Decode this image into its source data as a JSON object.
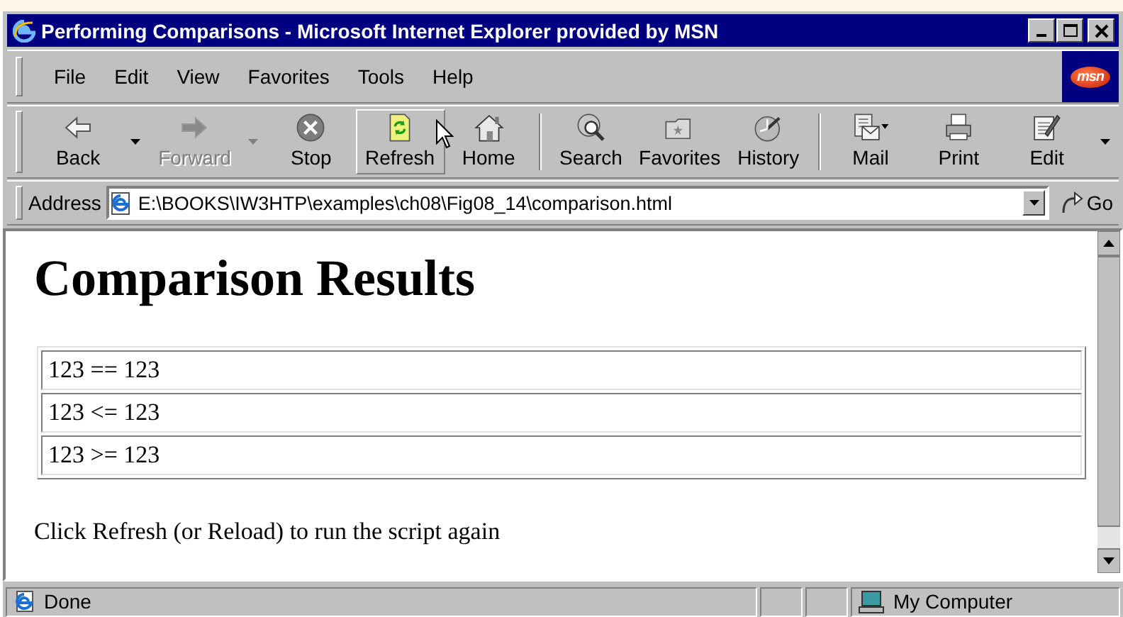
{
  "window": {
    "title": "Performing Comparisons - Microsoft Internet Explorer provided by MSN"
  },
  "menu": [
    {
      "label": "File"
    },
    {
      "label": "Edit"
    },
    {
      "label": "View"
    },
    {
      "label": "Favorites"
    },
    {
      "label": "Tools"
    },
    {
      "label": "Help"
    }
  ],
  "logo": {
    "text": "msn"
  },
  "toolbar": [
    {
      "kind": "split-button",
      "label": "Back",
      "disabled": false,
      "hovered": false
    },
    {
      "kind": "split-button",
      "label": "Forward",
      "disabled": true,
      "hovered": false
    },
    {
      "kind": "button",
      "label": "Stop",
      "disabled": false,
      "hovered": false
    },
    {
      "kind": "button",
      "label": "Refresh",
      "disabled": false,
      "hovered": true
    },
    {
      "kind": "button",
      "label": "Home",
      "disabled": false,
      "hovered": false
    },
    {
      "kind": "separator"
    },
    {
      "kind": "button",
      "label": "Search",
      "disabled": false,
      "hovered": false
    },
    {
      "kind": "button",
      "label": "Favorites",
      "disabled": false,
      "hovered": false
    },
    {
      "kind": "button",
      "label": "History",
      "disabled": false,
      "hovered": false
    },
    {
      "kind": "separator"
    },
    {
      "kind": "menu-button",
      "label": "Mail",
      "disabled": false,
      "hovered": false
    },
    {
      "kind": "button",
      "label": "Print",
      "disabled": false,
      "hovered": false
    },
    {
      "kind": "split-button",
      "label": "Edit",
      "disabled": false,
      "hovered": false
    }
  ],
  "address": {
    "label": "Address",
    "value": "E:\\BOOKS\\IW3HTP\\examples\\ch08\\Fig08_14\\comparison.html",
    "go": "Go"
  },
  "page": {
    "heading": "Comparison Results",
    "rows": [
      "123 == 123",
      "123 <= 123",
      "123 >= 123"
    ],
    "note": "Click Refresh (or Reload) to run the script again"
  },
  "status": {
    "text": "Done",
    "zone": "My Computer"
  }
}
